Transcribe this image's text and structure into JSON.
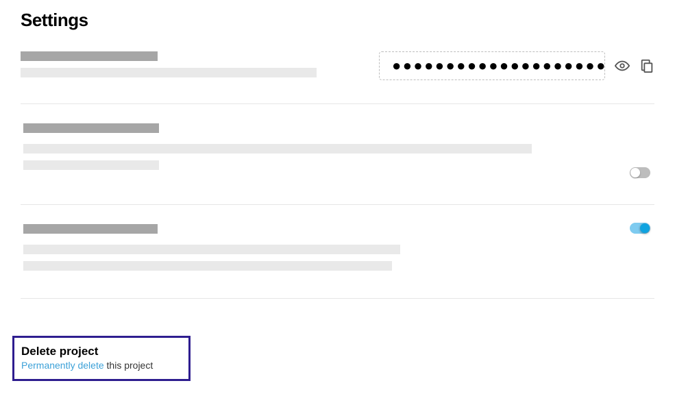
{
  "page_title": "Settings",
  "secret": {
    "masked": "●●●●●●●●●●●●●●●●●●●●●●●●●●●●●●●●●●"
  },
  "toggle1": {
    "state": "off"
  },
  "toggle2": {
    "state": "on"
  },
  "delete": {
    "title": "Delete project",
    "link_text": "Permanently delete",
    "suffix": " this project"
  }
}
